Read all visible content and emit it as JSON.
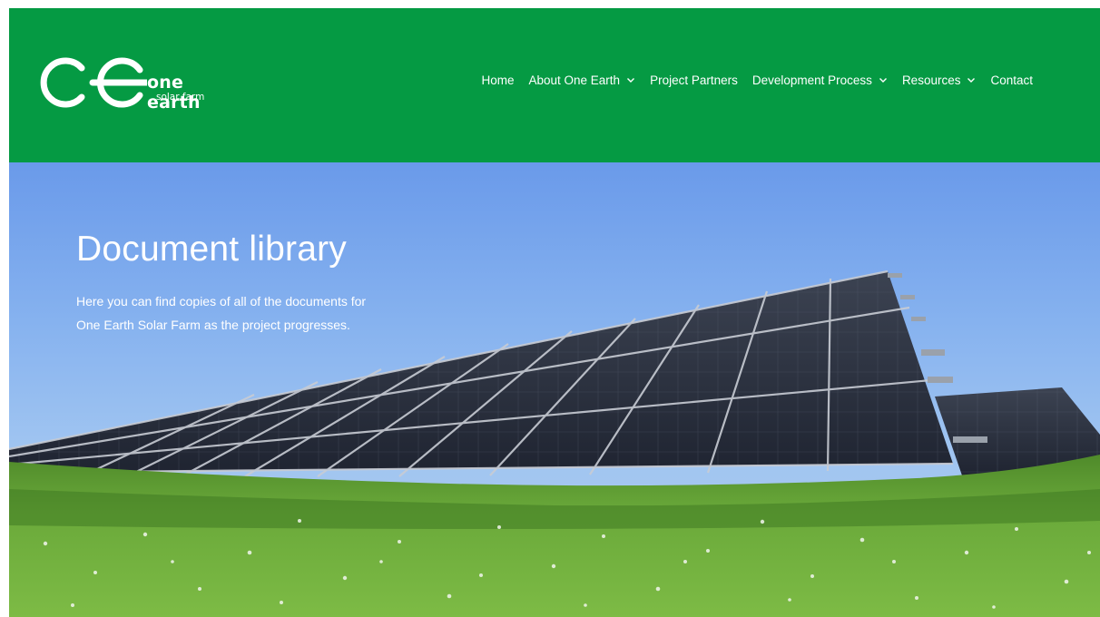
{
  "brand": {
    "name": "one earth",
    "tagline": "solar farm",
    "color": "#059a43"
  },
  "nav": [
    {
      "label": "Home",
      "has_dropdown": false
    },
    {
      "label": "About One Earth",
      "has_dropdown": true
    },
    {
      "label": "Project Partners",
      "has_dropdown": false
    },
    {
      "label": "Development Process",
      "has_dropdown": true
    },
    {
      "label": "Resources",
      "has_dropdown": true
    },
    {
      "label": "Contact",
      "has_dropdown": false
    }
  ],
  "hero": {
    "title": "Document library",
    "text": "Here you can find copies of all of the documents for One Earth Solar Farm as the project progresses."
  }
}
